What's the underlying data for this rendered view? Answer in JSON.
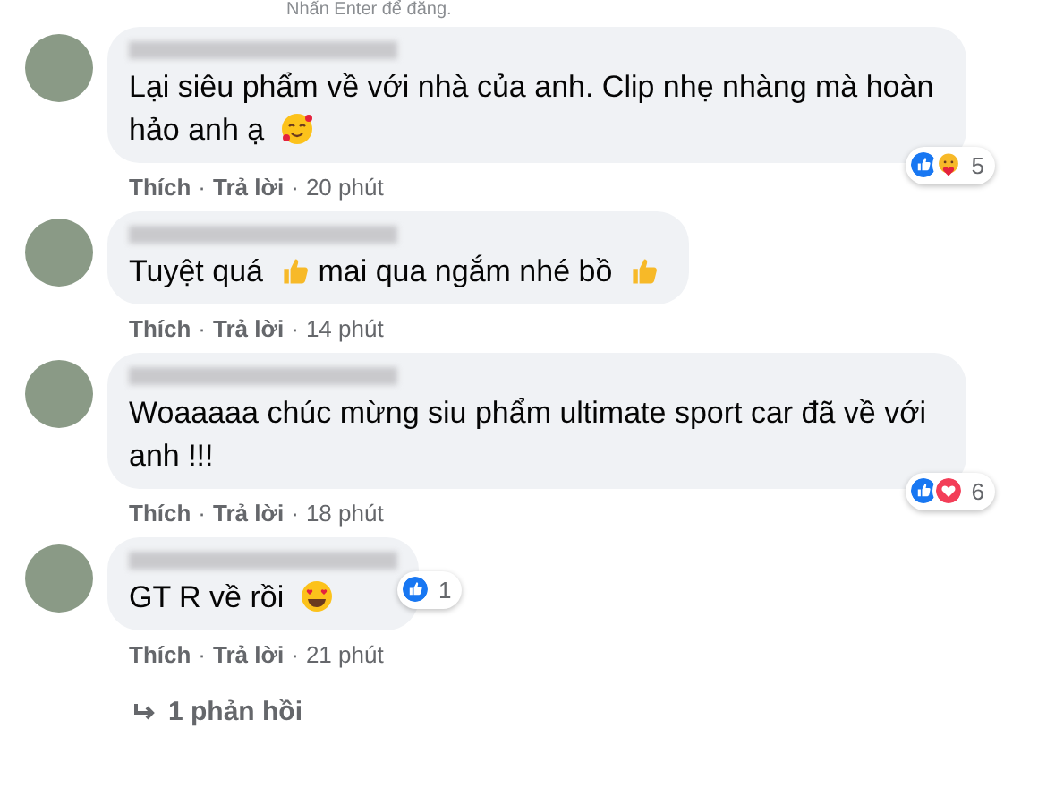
{
  "hint": "Nhấn Enter để đăng.",
  "separator": "·",
  "comments": [
    {
      "body": [
        {
          "kind": "text",
          "text": "Lại siêu phẩm về với nhà của anh. Clip nhẹ nhàng mà hoàn hảo anh ạ"
        },
        {
          "kind": "smiling-hearts"
        }
      ],
      "reactions": {
        "kind": "corner",
        "icons": [
          {
            "kind": "like"
          },
          {
            "kind": "care"
          }
        ],
        "count": "5"
      },
      "actions": {
        "like": "Thích",
        "reply": "Trả lời",
        "time": "20 phút"
      }
    },
    {
      "body": [
        {
          "kind": "text",
          "text": "Tuyệt quá"
        },
        {
          "kind": "thumbs-up"
        },
        {
          "kind": "text",
          "text": "mai qua ngắm nhé bồ"
        },
        {
          "kind": "thumbs-up"
        }
      ],
      "actions": {
        "like": "Thích",
        "reply": "Trả lời",
        "time": "14 phút"
      }
    },
    {
      "body": [
        {
          "kind": "text",
          "text": "Woaaaaa chúc mừng siu phẩm ultimate sport car đã về với anh !!!"
        }
      ],
      "reactions": {
        "kind": "corner",
        "icons": [
          {
            "kind": "like"
          },
          {
            "kind": "love"
          }
        ],
        "count": "6"
      },
      "actions": {
        "like": "Thích",
        "reply": "Trả lời",
        "time": "18 phút"
      }
    },
    {
      "body": [
        {
          "kind": "text",
          "text": "GT R về rồi"
        },
        {
          "kind": "heart-eyes"
        }
      ],
      "reactions": {
        "kind": "beside",
        "icons": [
          {
            "kind": "like"
          }
        ],
        "count": "1"
      },
      "actions": {
        "like": "Thích",
        "reply": "Trả lời",
        "time": "21 phút"
      }
    }
  ],
  "replies_link": "1 phản hồi"
}
